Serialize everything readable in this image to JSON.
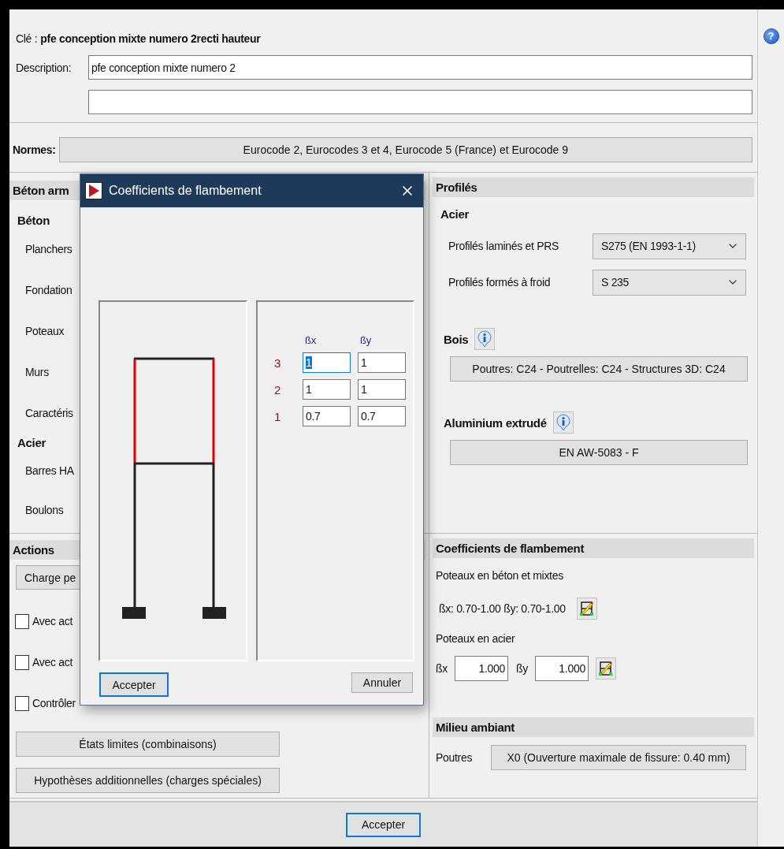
{
  "key": {
    "label": "Clé :",
    "value": "pfe conception mixte numero 2recti hauteur"
  },
  "help": {
    "symbol": "?"
  },
  "description": {
    "label": "Description:",
    "value": "pfe conception mixte numero 2"
  },
  "norms": {
    "label": "Normes:",
    "value": "Eurocode 2, Eurocodes 3 et 4, Eurocode 5 (France) et Eurocode 9"
  },
  "concrete": {
    "title": "Béton arm",
    "groups": [
      {
        "title": "Béton",
        "items": [
          "Planchers",
          "Fondation",
          "Poteaux",
          "Murs",
          "Caractéris"
        ]
      },
      {
        "title": "Acier",
        "items": [
          "Barres HA",
          "Boulons"
        ]
      }
    ]
  },
  "profiles": {
    "title": "Profilés",
    "steel_title": "Acier",
    "rows": [
      {
        "label": "Profilés laminés et PRS",
        "value": "S275 (EN 1993-1-1)"
      },
      {
        "label": "Profilés formés à froid",
        "value": "S 235"
      }
    ],
    "wood": {
      "title": "Bois",
      "value": "Poutres: C24 - Poutrelles: C24 - Structures 3D: C24"
    },
    "aluminium": {
      "title": "Aluminium extrudé",
      "value": "EN AW-5083 - F"
    }
  },
  "actions": {
    "title": "Actions",
    "load_button": "Charge pe",
    "checkboxes": [
      {
        "label": "Avec act",
        "checked": false
      },
      {
        "label": "Avec act",
        "checked": false
      },
      {
        "label": "Contrôler",
        "checked": false
      }
    ],
    "buttons": [
      "États limites (combinaisons)",
      "Hypothèses additionnelles (charges spéciales)"
    ]
  },
  "buckling": {
    "title": "Coefficients de flambement",
    "concrete_label": "Poteaux en béton et mixtes",
    "concrete_value": "ßx: 0.70-1.00 ßy: 0.70-1.00",
    "steel_label": "Poteaux en acier",
    "bx_label": "ßx",
    "bx_value": "1.000",
    "by_label": "ßy",
    "by_value": "1.000"
  },
  "environment": {
    "title": "Milieu ambiant",
    "label": "Poutres",
    "value": "X0 (Ouverture maximale de fissure: 0.40 mm)"
  },
  "footer": {
    "button": "Accepter"
  },
  "dialog": {
    "title": "Coefficients de flambement",
    "headers": [
      "ßx",
      "ßy"
    ],
    "rows": [
      {
        "storey": "3",
        "highlighted": true,
        "cells": [
          {
            "value": "1",
            "focused": true
          },
          {
            "value": "1",
            "focused": false
          }
        ]
      },
      {
        "storey": "2",
        "highlighted": false,
        "cells": [
          {
            "value": "1",
            "focused": false
          },
          {
            "value": "1",
            "focused": false
          }
        ]
      },
      {
        "storey": "1",
        "highlighted": false,
        "cells": [
          {
            "value": "0.7",
            "focused": false
          },
          {
            "value": "0.7",
            "focused": false
          }
        ]
      }
    ],
    "accept": "Accepter",
    "cancel": "Annuler"
  }
}
